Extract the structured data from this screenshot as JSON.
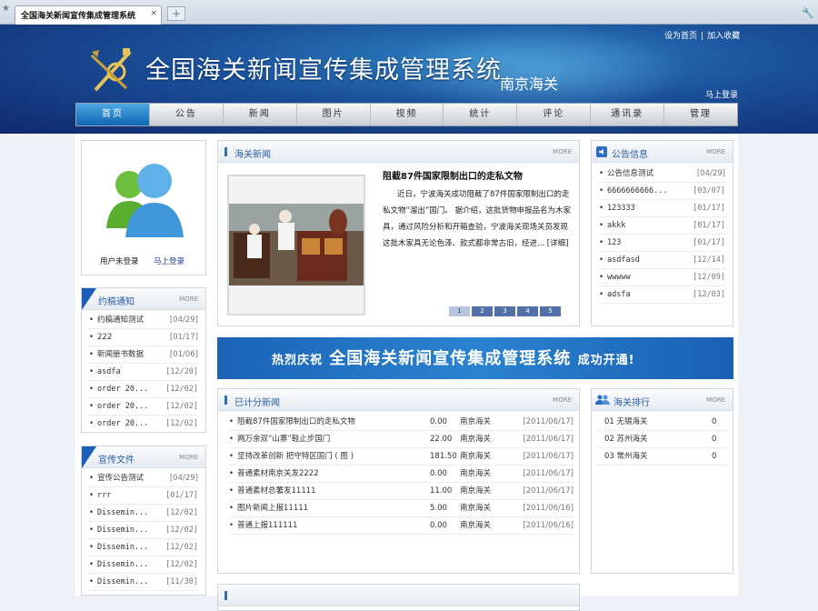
{
  "browser": {
    "tab_title": "全国海关新闻宣传集成管理系统",
    "close_glyph": "×",
    "new_tab_glyph": "+"
  },
  "header": {
    "site_title": "全国海关新闻宣传集成管理系统",
    "subtitle": "南京海关",
    "links": [
      "设为首页",
      "加入收藏"
    ],
    "login_link": "马上登录"
  },
  "nav": {
    "items": [
      "首页",
      "公告",
      "新闻",
      "图片",
      "视频",
      "统计",
      "评论",
      "通讯录",
      "管理"
    ],
    "active": "首页"
  },
  "user_box": {
    "status": "用户未登录",
    "login": "马上登录"
  },
  "news": {
    "title": "海关新闻",
    "more": "MORE",
    "headline": "阻截87件国家限制出口的走私文物",
    "body": "近日，宁波海关成功阻截了87件国家限制出口的走私文物“溜出”国门。    据介绍，这批货物申报品名为木家具，通过风险分析和开箱查验，宁波海关现场关员发现这批木家具无论色泽、款式都非常古旧，经进... [详细]",
    "pages": [
      "1",
      "2",
      "3",
      "4",
      "5"
    ]
  },
  "notices": {
    "title": "公告信息",
    "more": "MORE",
    "items": [
      {
        "text": "公告信息测试",
        "date": "[04/29]"
      },
      {
        "text": "6666666666...",
        "date": "[03/07]"
      },
      {
        "text": "123333",
        "date": "[01/17]"
      },
      {
        "text": "akkk",
        "date": "[01/17]"
      },
      {
        "text": "123",
        "date": "[01/17]"
      },
      {
        "text": "asdfasd",
        "date": "[12/14]"
      },
      {
        "text": "wwwww",
        "date": "[12/09]"
      },
      {
        "text": "adsfa",
        "date": "[12/03]"
      }
    ]
  },
  "contrib": {
    "title": "约稿通知",
    "more": "MORE",
    "items": [
      {
        "text": "约稿通知测试",
        "date": "[04/29]"
      },
      {
        "text": "222",
        "date": "[01/17]"
      },
      {
        "text": "新闻册书数据",
        "date": "[01/06]"
      },
      {
        "text": "asdfa",
        "date": "[12/20]"
      },
      {
        "text": "order 20...",
        "date": "[12/02]"
      },
      {
        "text": "order 20...",
        "date": "[12/02]"
      },
      {
        "text": "order 20...",
        "date": "[12/02]"
      }
    ]
  },
  "publicity": {
    "title": "宣传文件",
    "more": "MORE",
    "items": [
      {
        "text": "宣传公告测试",
        "date": "[04/29]"
      },
      {
        "text": "rrr",
        "date": "[01/17]"
      },
      {
        "text": "Dissemin...",
        "date": "[12/02]"
      },
      {
        "text": "Dissemin...",
        "date": "[12/02]"
      },
      {
        "text": "Dissemin...",
        "date": "[12/02]"
      },
      {
        "text": "Dissemin...",
        "date": "[12/02]"
      },
      {
        "text": "Dissemin...",
        "date": "[11/30]"
      }
    ]
  },
  "banner": {
    "prefix": "热烈庆祝",
    "name": "全国海关新闻宣传集成管理系统",
    "suffix": "成功开通!"
  },
  "scored": {
    "title": "已计分新闻",
    "more": "MORE",
    "items": [
      {
        "text": "阻截87件国家限制出口的走私文物",
        "score": "0.00",
        "org": "南京海关",
        "date": "[2011/06/17]"
      },
      {
        "text": "两万余双“山寨”鞋止步国门",
        "score": "22.00",
        "org": "南京海关",
        "date": "[2011/06/17]"
      },
      {
        "text": "坚持改革创新 把守特区国门 ( 图 )",
        "score": "181.50",
        "org": "南京海关",
        "date": "[2011/06/17]"
      },
      {
        "text": "普通素材南京关发2222",
        "score": "0.00",
        "org": "南京海关",
        "date": "[2011/06/17]"
      },
      {
        "text": "普通素材总署发11111",
        "score": "11.00",
        "org": "南京海关",
        "date": "[2011/06/17]"
      },
      {
        "text": "图片新闻上报11111",
        "score": "5.00",
        "org": "南京海关",
        "date": "[2011/06/16]"
      },
      {
        "text": "普通上报111111",
        "score": "0.00",
        "org": "南京海关",
        "date": "[2011/06/16]"
      }
    ]
  },
  "rank": {
    "title": "海关排行",
    "more": "MORE",
    "items": [
      {
        "no": "01",
        "name": "无锡海关",
        "count": "0"
      },
      {
        "no": "02",
        "name": "苏州海关",
        "count": "0"
      },
      {
        "no": "03",
        "name": "常州海关",
        "count": "0"
      }
    ]
  },
  "colors": {
    "header_blue": "#1a4f98",
    "nav_active": "#0f66b3",
    "panel_title": "#2a5ea5"
  }
}
